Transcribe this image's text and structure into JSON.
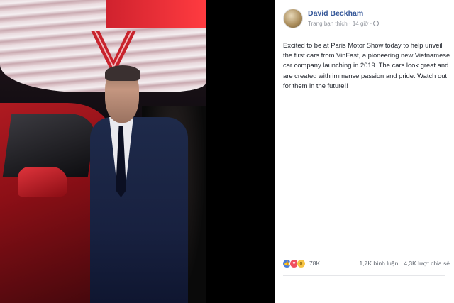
{
  "post": {
    "author": "David Beckham",
    "meta_text": "Trang bạn thích · 14 giờ ·",
    "body": "Excited to be at Paris Motor Show today to help unveil the first cars from VinFast, a pioneering new Vietnamese car company launching in 2019. The cars look great and are created with immense passion and pride. Watch out for them in the future!!",
    "reactions_count": "78K",
    "comments": "1,7K bình luận",
    "shares": "4,3K lượt chia sẻ",
    "reaction_icons": [
      "like-icon",
      "love-icon",
      "wow-icon"
    ]
  },
  "colors": {
    "author_link": "#365899",
    "like": "#4a7ed9",
    "love": "#f0505f",
    "wow": "#f6c444",
    "brand_red": "#d0222e"
  }
}
